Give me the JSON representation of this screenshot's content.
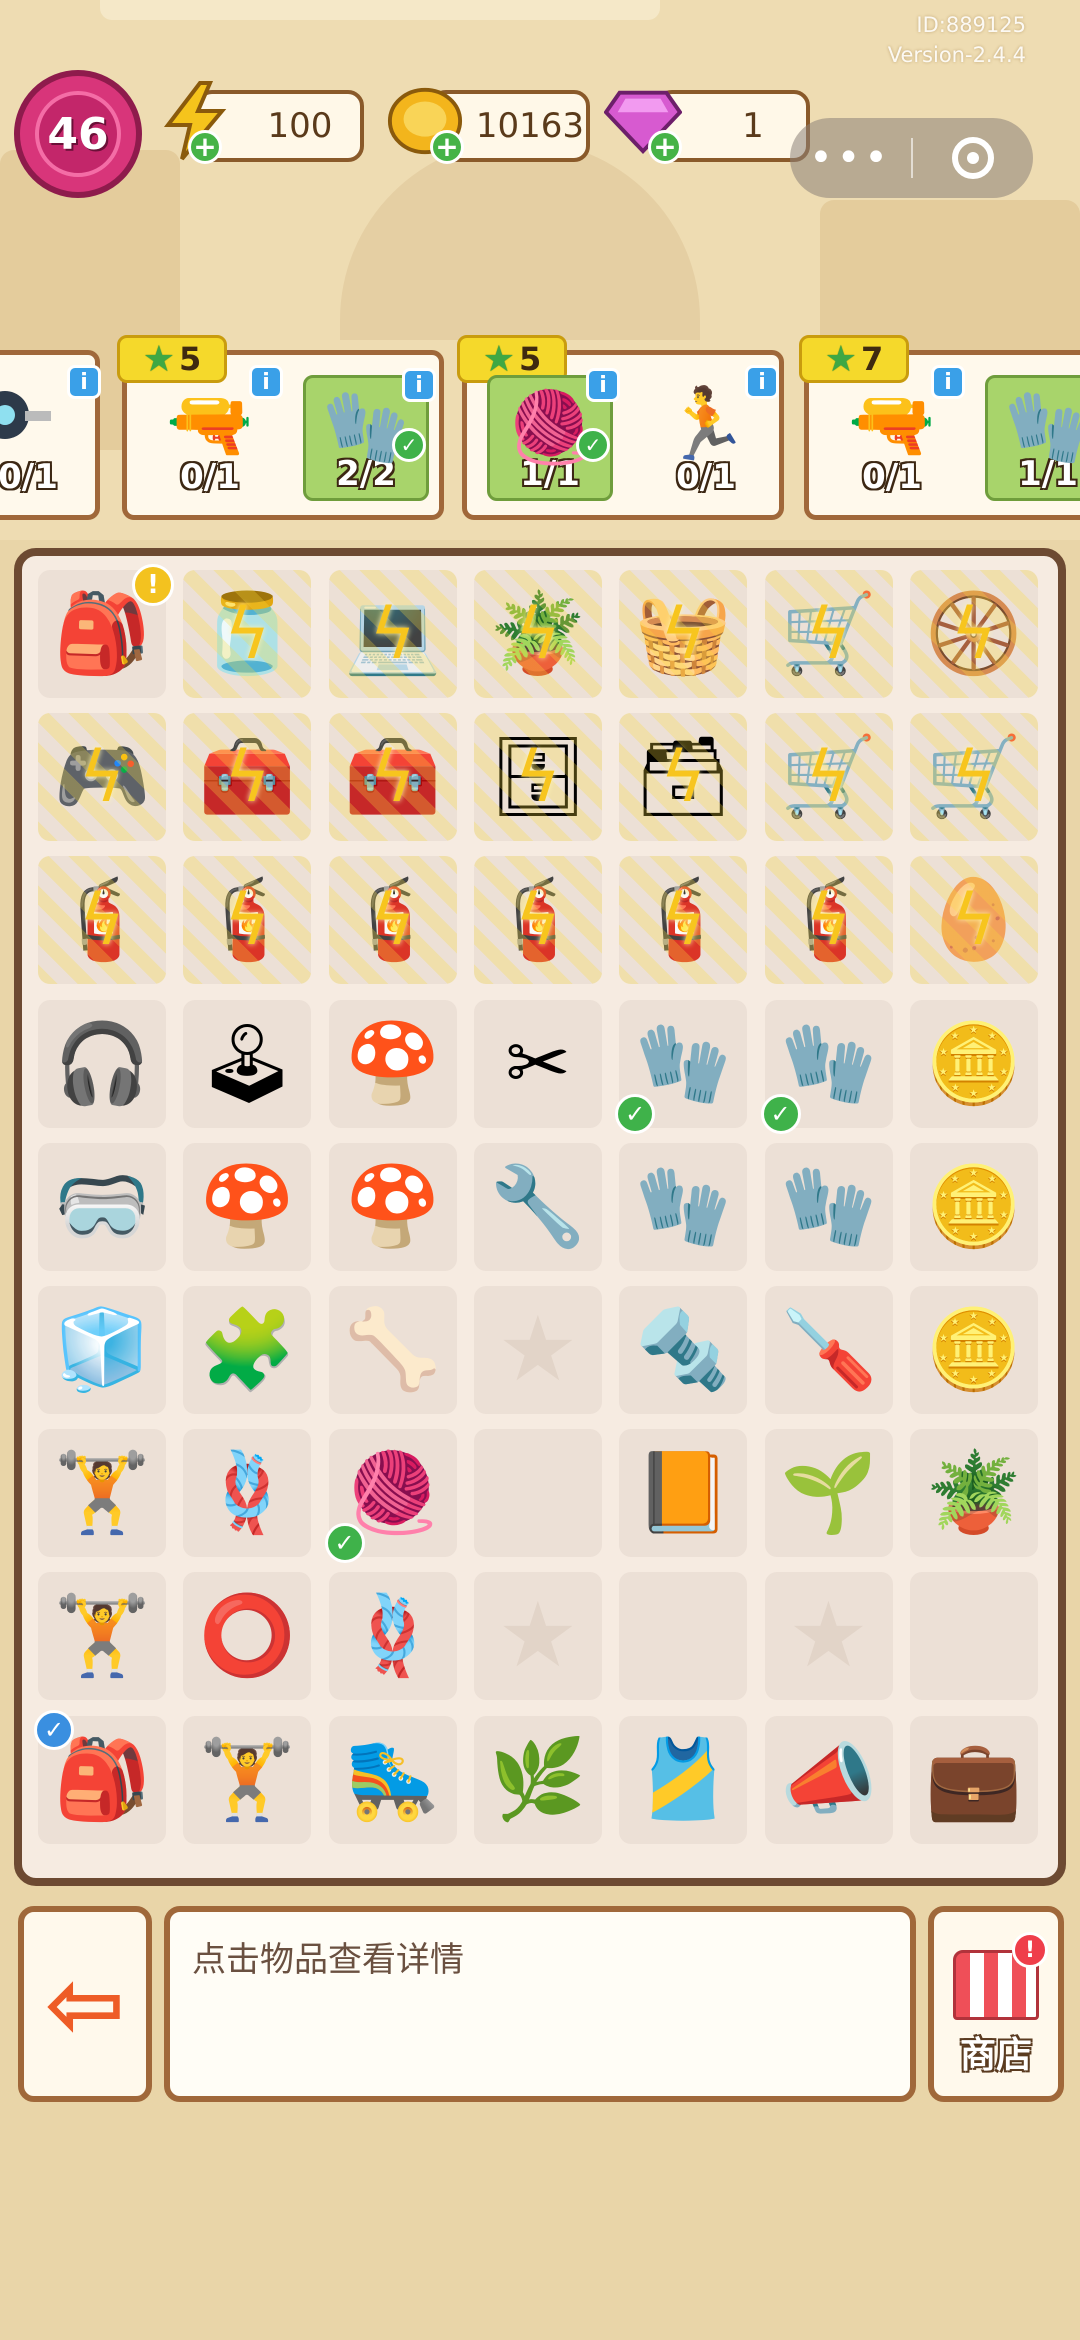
{
  "header": {
    "id_text": "ID:889125",
    "version_text": "Version-2.4.4",
    "level": "46",
    "energy": "100",
    "coins": "10163",
    "gems": "1"
  },
  "capsule": {
    "more_icon": "more-dots-icon",
    "close_icon": "record-circle-icon"
  },
  "orders": [
    {
      "stars": "",
      "items": [
        {
          "icon": "wheel-icon",
          "count": "0/1",
          "done": false
        }
      ]
    },
    {
      "stars": "5",
      "items": [
        {
          "icon": "drill-icon",
          "count": "0/1",
          "done": false
        },
        {
          "icon": "glove-icon",
          "count": "2/2",
          "done": true
        }
      ]
    },
    {
      "stars": "5",
      "items": [
        {
          "icon": "yarn-icon",
          "count": "1/1",
          "done": true
        },
        {
          "icon": "treadmill-icon",
          "count": "0/1",
          "done": false
        }
      ]
    },
    {
      "stars": "7",
      "items": [
        {
          "icon": "drill-icon",
          "count": "0/1",
          "done": false
        },
        {
          "icon": "glove-icon",
          "count": "1/1",
          "done": true
        }
      ]
    }
  ],
  "board": [
    [
      {
        "icon": "🎒",
        "locked": false,
        "alert": true
      },
      {
        "icon": "🫙",
        "locked": true
      },
      {
        "icon": "💻",
        "locked": true
      },
      {
        "icon": "🪴",
        "locked": true
      },
      {
        "icon": "🧺",
        "locked": true
      },
      {
        "icon": "🛒",
        "locked": true
      },
      {
        "icon": "🛞",
        "locked": true
      }
    ],
    [
      {
        "icon": "🎮",
        "locked": true
      },
      {
        "icon": "🧰",
        "locked": true
      },
      {
        "icon": "🧰",
        "locked": true
      },
      {
        "icon": "🗄",
        "locked": true
      },
      {
        "icon": "🗃",
        "locked": true
      },
      {
        "icon": "🛒",
        "locked": true
      },
      {
        "icon": "🛒",
        "locked": true
      }
    ],
    [
      {
        "icon": "🧯",
        "locked": true
      },
      {
        "icon": "🧯",
        "locked": true
      },
      {
        "icon": "🧯",
        "locked": true
      },
      {
        "icon": "🧯",
        "locked": true
      },
      {
        "icon": "🧯",
        "locked": true
      },
      {
        "icon": "🧯",
        "locked": true
      },
      {
        "icon": "🥚",
        "locked": true
      }
    ],
    [
      {
        "icon": "🎧"
      },
      {
        "icon": "🕹"
      },
      {
        "icon": "🍄"
      },
      {
        "icon": "✂"
      },
      {
        "icon": "🧤",
        "check": true
      },
      {
        "icon": "🧤",
        "check": true
      },
      {
        "icon": "🪙"
      }
    ],
    [
      {
        "icon": "🥽"
      },
      {
        "icon": "🍄"
      },
      {
        "icon": "🍄"
      },
      {
        "icon": "🔧"
      },
      {
        "icon": "🧤"
      },
      {
        "icon": "🧤"
      },
      {
        "icon": "🪙"
      }
    ],
    [
      {
        "icon": "🧊"
      },
      {
        "icon": "🧩"
      },
      {
        "icon": "🦴"
      },
      {
        "icon": "★",
        "empty": true
      },
      {
        "icon": "🔩"
      },
      {
        "icon": "🪛"
      },
      {
        "icon": "🪙"
      }
    ],
    [
      {
        "icon": "🏋"
      },
      {
        "icon": "🪢"
      },
      {
        "icon": "🧶",
        "check": true
      },
      {
        "icon": ""
      },
      {
        "icon": "📙"
      },
      {
        "icon": "🌱"
      },
      {
        "icon": "🪴"
      }
    ],
    [
      {
        "icon": "🏋"
      },
      {
        "icon": "⭕"
      },
      {
        "icon": "🪢"
      },
      {
        "icon": "★",
        "empty": true
      },
      {
        "icon": ""
      },
      {
        "icon": "★",
        "empty": true
      },
      {
        "icon": ""
      }
    ],
    [
      {
        "icon": "🎒",
        "bluecheck": true
      },
      {
        "icon": "🏋"
      },
      {
        "icon": "🛼"
      },
      {
        "icon": "🌿"
      },
      {
        "icon": "🎽"
      },
      {
        "icon": "📣"
      },
      {
        "icon": "💼"
      }
    ]
  ],
  "bottom": {
    "detail_text": "点击物品查看详情",
    "shop_label": "商店",
    "shop_alert": "!"
  }
}
